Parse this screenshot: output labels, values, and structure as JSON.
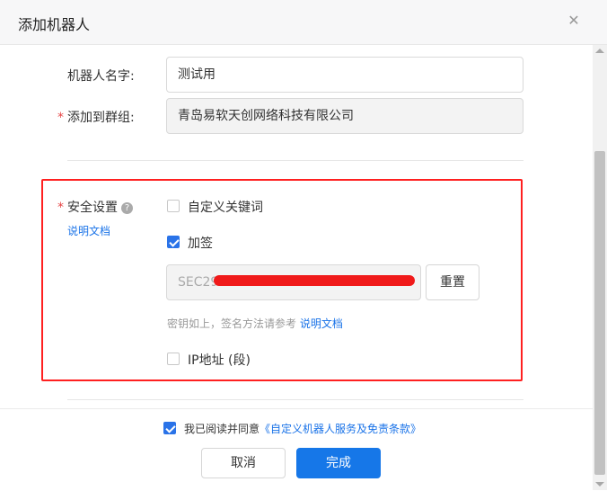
{
  "dialog": {
    "title": "添加机器人",
    "close_icon": "close-icon"
  },
  "form": {
    "name_label": "机器人名字:",
    "name_value": "测试用",
    "group_label": "添加到群组:",
    "group_required": "*",
    "group_value": "青岛易软天创网络科技有限公司"
  },
  "security": {
    "required": "*",
    "label": "安全设置",
    "help_icon": "question-circle-icon",
    "help_char": "?",
    "doc_link": "说明文档",
    "keyword_label": "自定义关键词",
    "keyword_checked": false,
    "sign_label": "加签",
    "sign_checked": true,
    "secret_value": "SEC29",
    "reset_label": "重置",
    "hint_text": "密钥如上，签名方法请参考",
    "hint_link": "说明文档",
    "ip_label": "IP地址 (段)",
    "ip_checked": false
  },
  "footer": {
    "agree_checked": true,
    "agree_text": "我已阅读并同意",
    "agree_link": "《自定义机器人服务及免责条款》",
    "cancel_label": "取消",
    "confirm_label": "完成"
  },
  "colors": {
    "primary": "#1677e8",
    "highlight_box": "#ff2020",
    "required": "#e64545"
  }
}
